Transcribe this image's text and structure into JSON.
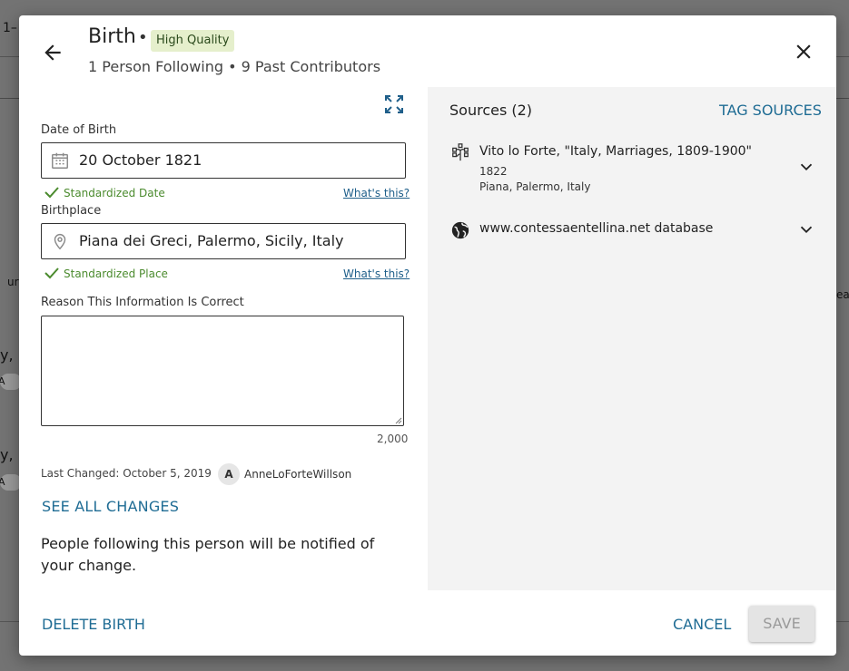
{
  "background": {
    "frag_top": "1–",
    "frag_mid_left": "ur",
    "frag_mid_right": "ea",
    "frag_row1": "y, I",
    "frag_row2": "y, I",
    "badge1": "A",
    "badge2": "A"
  },
  "header": {
    "title": "Birth",
    "separator": "•",
    "quality_badge": "High Quality",
    "subtitle": "1 Person Following • 9 Past Contributors"
  },
  "form": {
    "date_label": "Date of Birth",
    "date_value": "20 October 1821",
    "date_status": "Standardized Date",
    "whats_this": "What's this?",
    "place_label": "Birthplace",
    "place_value": "Piana dei Greci, Palermo, Sicily, Italy",
    "place_status": "Standardized Place",
    "reason_label": "Reason This Information Is Correct",
    "reason_value": "",
    "char_counter": "2,000"
  },
  "history": {
    "last_changed": "Last Changed: October 5, 2019",
    "avatar_initial": "A",
    "user": "AnneLoForteWillson",
    "see_all": "SEE ALL CHANGES"
  },
  "notice": "People following this person will be notified of your change.",
  "sources": {
    "title": "Sources (2)",
    "tag_label": "TAG SOURCES",
    "items": [
      {
        "icon": "family-tree-icon",
        "title": "Vito lo Forte, \"Italy, Marriages, 1809-1900\"",
        "date": "1822",
        "place": "Piana, Palermo, Italy"
      },
      {
        "icon": "globe-icon",
        "title": "www.contessaentellina.net database"
      }
    ]
  },
  "footer": {
    "delete": "DELETE BIRTH",
    "cancel": "CANCEL",
    "save": "SAVE"
  },
  "colors": {
    "accent": "#1f6c94",
    "success": "#4b8b2e",
    "badge_bg": "#e5efcc",
    "panel_bg": "#f3f3f3"
  }
}
